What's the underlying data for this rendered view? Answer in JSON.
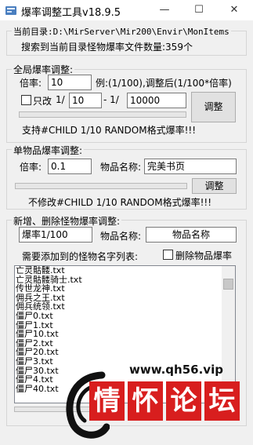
{
  "window": {
    "title": "爆率调整工具v18.9.5",
    "minimize_glyph": "—",
    "maximize_glyph": "☐",
    "close_glyph": "✕"
  },
  "info": {
    "current_dir_label": "当前目录:D:\\MirServer\\Mir200\\Envir\\MonItems",
    "search_result": "搜索到当前目录怪物爆率文件数量:359个"
  },
  "global": {
    "group_title": "全局爆率调整:",
    "rate_label": "倍率:",
    "rate_value": "10",
    "example_text": "例:(1/100),调整后(1/100*倍率)",
    "only_change_label": "只改",
    "one_over_1": "1/",
    "min_value": "10",
    "dash_one_over": "- 1/",
    "max_value": "10000",
    "adjust_button": "调整",
    "support_text": "支持#CHILD 1/10 RANDOM格式爆率!!!"
  },
  "single": {
    "group_title": "单物品爆率调整:",
    "rate_label": "倍率:",
    "rate_value": "0.1",
    "item_name_label": "物品名称:",
    "item_name_value": "完美书页",
    "adjust_button": "调整",
    "note_text": "不修改#CHILD 1/10 RANDOM格式爆率!!!"
  },
  "add_remove": {
    "group_title": "新增、删除怪物爆率调整:",
    "rate_value": "爆率1/100",
    "item_name_label": "物品名称:",
    "item_name_value": "物品名称",
    "monster_text_label": "需要添加到的怪物名字列表:",
    "delete_checkbox_label": "删除物品爆率"
  },
  "monster_list": [
    "亡灵骷髅.txt",
    "亡灵骷髅骑士.txt",
    "传世龙神.txt",
    "佣兵之王.txt",
    "佣兵统领.txt",
    "僵尸0.txt",
    "僵尸1.txt",
    "僵尸10.txt",
    "僵尸2.txt",
    "僵尸20.txt",
    "僵尸3.txt",
    "僵尸30.txt",
    "僵尸4.txt",
    "僵尸40.txt"
  ],
  "watermark": {
    "url": "www.qh56.vip",
    "chars": [
      "情",
      "怀",
      "论",
      "坛"
    ]
  }
}
